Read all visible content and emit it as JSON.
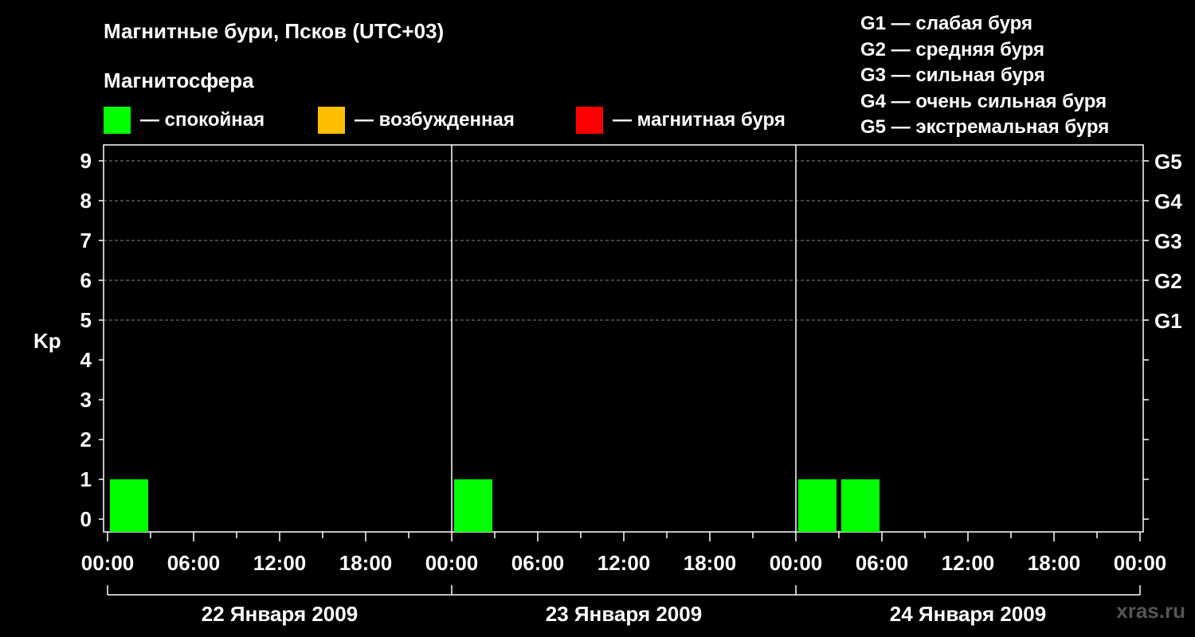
{
  "title": "Магнитные бури, Псков (UTC+03)",
  "subtitle": "Магнитосфера",
  "legend": [
    {
      "label": "— спокойная",
      "color": "#00ff00"
    },
    {
      "label": "— возбужденная",
      "color": "#ffbf00"
    },
    {
      "label": "— магнитная буря",
      "color": "#ff0000"
    }
  ],
  "g_legend": [
    "G1 — слабая буря",
    "G2 — средняя буря",
    "G3 — сильная буря",
    "G4 — очень сильная буря",
    "G5 — экстремальная буря"
  ],
  "watermark": "xras.ru",
  "chart_data": {
    "type": "bar",
    "title": "Магнитные бури, Псков (UTC+03)",
    "ylabel": "Kp",
    "ylim": [
      0,
      9
    ],
    "y_ticks": [
      "0",
      "1",
      "2",
      "3",
      "4",
      "5",
      "6",
      "7",
      "8",
      "9"
    ],
    "right_ticks": [
      {
        "kp": 5,
        "label": "G1"
      },
      {
        "kp": 6,
        "label": "G2"
      },
      {
        "kp": 7,
        "label": "G3"
      },
      {
        "kp": 8,
        "label": "G4"
      },
      {
        "kp": 9,
        "label": "G5"
      }
    ],
    "x_tick_labels": [
      "00:00",
      "06:00",
      "12:00",
      "18:00",
      "00:00",
      "06:00",
      "12:00",
      "18:00",
      "00:00",
      "06:00",
      "12:00",
      "18:00",
      "00:00"
    ],
    "days": [
      "22 Января 2009",
      "23 Января 2009",
      "24 Января 2009"
    ],
    "grid": "dashed horizontal at Kp 5-9",
    "bars": [
      {
        "day": 0,
        "start_hour": 0,
        "kp": 1,
        "level": "спокойная",
        "color": "#00ff00"
      },
      {
        "day": 1,
        "start_hour": 0,
        "kp": 1,
        "level": "спокойная",
        "color": "#00ff00"
      },
      {
        "day": 2,
        "start_hour": 0,
        "kp": 1,
        "level": "спокойная",
        "color": "#00ff00"
      },
      {
        "day": 2,
        "start_hour": 3,
        "kp": 1,
        "level": "спокойная",
        "color": "#00ff00"
      }
    ]
  }
}
